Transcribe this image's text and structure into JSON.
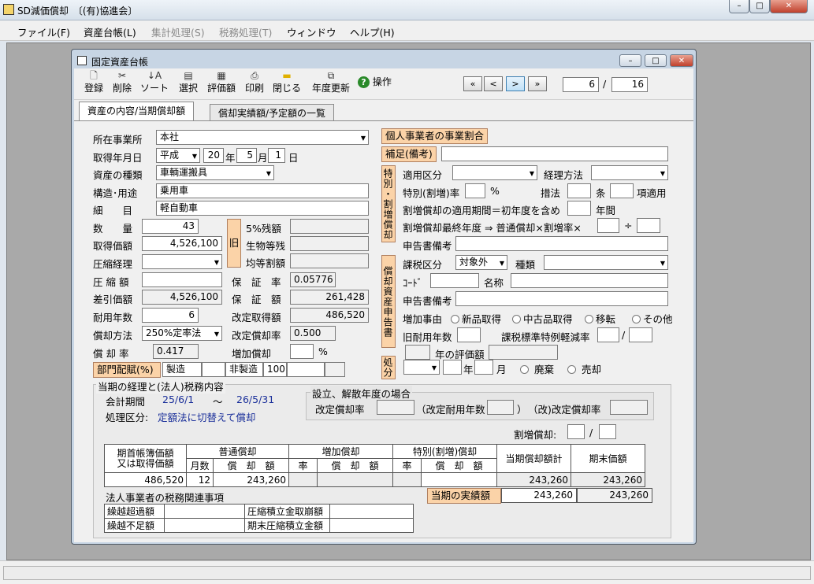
{
  "app": {
    "title": "SD減価償却　〔(有)協進会〕"
  },
  "menu": [
    "ファイル(F)",
    "資産台帳(L)",
    "集計処理(S)",
    "税務処理(T)",
    "ウィンドウ",
    "ヘルプ(H)"
  ],
  "window": {
    "title": "固定資産台帳"
  },
  "toolbar": {
    "buttons": [
      "登録",
      "削除",
      "ソート",
      "選択",
      "評価額",
      "印刷",
      "閉じる",
      "年度更新"
    ],
    "help": "操作",
    "nav": [
      "«",
      "<",
      ">",
      "»"
    ],
    "record_current": "6",
    "record_sep": "/",
    "record_total": "16"
  },
  "tabs": [
    "資産の内容/当期償却額",
    "償却実績額/予定額の一覧"
  ],
  "form": {
    "location_label": "所在事業所",
    "location": "本社",
    "acq_date_label": "取得年月日",
    "era": "平成",
    "year": "20",
    "year_unit": "年",
    "month": "5",
    "month_unit": "月",
    "day": "1",
    "day_unit": "日",
    "type_label": "資産の種類",
    "type": "車輌運搬具",
    "structure_label": "構造･用途",
    "structure": "乗用車",
    "detail_label": "細　　目",
    "detail": "軽自動車",
    "qty_label": "数　　量",
    "qty": "43",
    "cost_label": "取得価額",
    "cost": "4,526,100",
    "old_badge": "旧",
    "residual5_label": "5%残額",
    "bio_label": "生物等残",
    "equal_label": "均等割額",
    "compress_label": "圧縮経理",
    "compress_amt_label": "圧 縮 額",
    "guarantee_rate_label": "保　証　率",
    "guarantee_rate": "0.05776",
    "net_label": "差引価額",
    "net": "4,526,100",
    "guarantee_amt_label": "保　証　額",
    "guarantee_amt": "261,428",
    "life_label": "耐用年数",
    "life": "6",
    "revised_cost_label": "改定取得額",
    "revised_cost": "486,520",
    "method_label": "償却方法",
    "method": "250%定率法",
    "revised_rate_label": "改定償却率",
    "revised_rate": "0.500",
    "rate_label": "償 却 率",
    "rate": "0.417",
    "increase_label": "増加償却",
    "increase_unit": "%",
    "dept_label": "部門配賦(%)",
    "dept_mfg": "製造",
    "dept_nonmfg": "非製造",
    "dept_nonmfg_val": "100"
  },
  "right": {
    "biz_ratio": "個人事業者の事業割合",
    "note_label": "補足(備考)",
    "special_vert": "特別・割増償却",
    "apply_label": "適用区分",
    "acct_label": "経理方法",
    "special_rate_label": "特別(割増)率",
    "special_rate_unit": "%",
    "measure_label": "措法",
    "article_label": "条",
    "clause_label": "項適用",
    "period_label": "割増償却の適用期間＝初年度を含め",
    "period_unit": "年間",
    "final_label": "割増償却最終年度 ⇒ 普通償却×割増率×",
    "div": "÷",
    "report_note_label": "申告書備考",
    "tax_vert": "償却資産申告書",
    "tax_cat_label": "課税区分",
    "tax_cat": "対象外",
    "kind_label": "種類",
    "code_label": "ｺｰﾄﾞ",
    "name_label": "名称",
    "report_note2_label": "申告書備考",
    "reason_label": "増加事由",
    "reasons": [
      "新品取得",
      "中古品取得",
      "移転",
      "その他"
    ],
    "old_life_label": "旧耐用年数",
    "reduction_label": "課税標準特例軽減率",
    "slash": "/",
    "eval_label": "年の評価額",
    "disposal_vert": "処分",
    "disp_year": "年",
    "disp_month": "月",
    "disp_opts": [
      "廃棄",
      "売却"
    ]
  },
  "period": {
    "group_title": "当期の経理と(法人)税務内容",
    "fiscal_label": "会計期間",
    "fiscal_from": "25/6/1",
    "fiscal_tilde": "〜",
    "fiscal_to": "26/5/31",
    "proc_label": "処理区分:",
    "proc_value": "定額法に切替えて償却",
    "setup_title": "設立、解散年度の場合",
    "setup_rate_label": "改定償却率",
    "setup_life_label": "（改定耐用年数",
    "setup_close": "）",
    "setup_rev_label": "（改)改定償却率",
    "extra_label": "割増償却:",
    "extra_slash": "/"
  },
  "table": {
    "h_start1": "期首帳簿価額",
    "h_start2": "又は取得価額",
    "h_normal": "普通償却",
    "h_increase": "増加償却",
    "h_special": "特別(割増)償却",
    "h_total": "当期償却額計",
    "h_end": "期末価額",
    "h_months": "月数",
    "h_amount": "償　却　額",
    "h_rate": "率",
    "start": "486,520",
    "months": "12",
    "amount": "243,260",
    "total": "243,260",
    "end": "243,260",
    "actual_label": "当期の実績額",
    "actual_total": "243,260",
    "actual_end": "243,260"
  },
  "corp": {
    "title": "法人事業者の税務関連事項",
    "over_label": "繰越超過額",
    "short_label": "繰越不足額",
    "reserve_label": "圧縮積立金取崩額",
    "reserve_end_label": "期末圧縮積立金額"
  }
}
